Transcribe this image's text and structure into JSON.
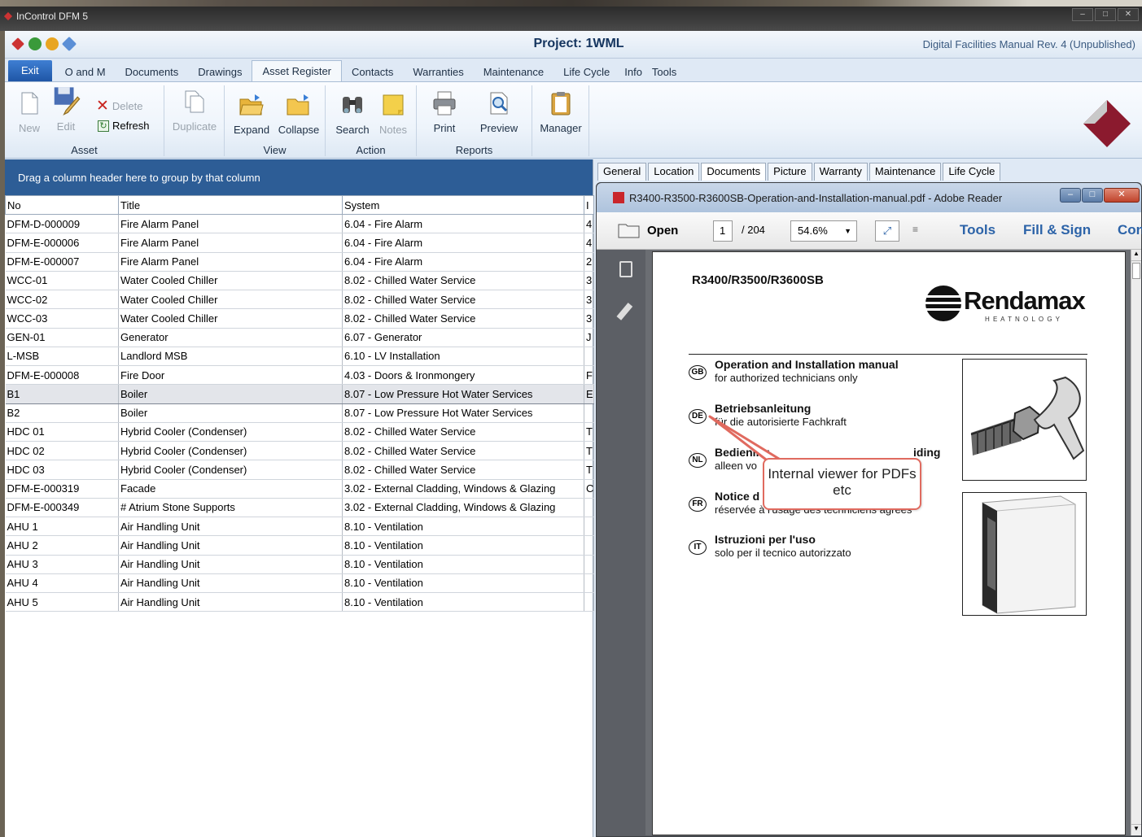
{
  "window": {
    "app_name": "InControl DFM 5"
  },
  "header": {
    "project_title": "Project: 1WML",
    "manual_rev": "Digital Facilities Manual Rev. 4 (Unpublished)"
  },
  "tabs": [
    "Exit",
    "O and M",
    "Documents",
    "Drawings",
    "Asset Register",
    "Contacts",
    "Warranties",
    "Maintenance",
    "Life Cycle",
    "Info",
    "Tools"
  ],
  "ribbon": {
    "asset": {
      "label": "Asset",
      "new": "New",
      "edit": "Edit",
      "delete": "Delete",
      "refresh": "Refresh",
      "duplicate": "Duplicate"
    },
    "view": {
      "label": "View",
      "expand": "Expand",
      "collapse": "Collapse"
    },
    "action": {
      "label": "Action",
      "search": "Search",
      "notes": "Notes"
    },
    "reports": {
      "label": "Reports",
      "print": "Print",
      "preview": "Preview"
    },
    "manager": "Manager"
  },
  "grid": {
    "group_hint": "Drag a column header here to group by that column",
    "columns": [
      "No",
      "Title",
      "System",
      "I"
    ],
    "rows": [
      [
        "DFM-D-000009",
        "Fire Alarm Panel",
        "6.04 - Fire Alarm",
        "4"
      ],
      [
        "DFM-E-000006",
        "Fire Alarm Panel",
        "6.04 - Fire Alarm",
        "4"
      ],
      [
        "DFM-E-000007",
        "Fire Alarm Panel",
        "6.04 - Fire Alarm",
        "2"
      ],
      [
        "WCC-01",
        "Water Cooled Chiller",
        "8.02 - Chilled Water Service",
        "3"
      ],
      [
        "WCC-02",
        "Water Cooled Chiller",
        "8.02 - Chilled Water Service",
        "3"
      ],
      [
        "WCC-03",
        "Water Cooled Chiller",
        "8.02 - Chilled Water Service",
        "3"
      ],
      [
        "GEN-01",
        "Generator",
        "6.07 - Generator",
        "J"
      ],
      [
        "L-MSB",
        "Landlord MSB",
        "6.10 - LV Installation",
        ""
      ],
      [
        "DFM-E-000008",
        "Fire Door",
        "4.03 - Doors & Ironmongery",
        "F"
      ],
      [
        "B1",
        "Boiler",
        "8.07 - Low Pressure Hot Water Services",
        "E"
      ],
      [
        "B2",
        "Boiler",
        "8.07 - Low Pressure Hot Water Services",
        ""
      ],
      [
        "HDC 01",
        "Hybrid Cooler (Condenser)",
        "8.02 - Chilled Water Service",
        "T"
      ],
      [
        "HDC 02",
        "Hybrid Cooler (Condenser)",
        "8.02 - Chilled Water Service",
        "T"
      ],
      [
        "HDC 03",
        "Hybrid Cooler (Condenser)",
        "8.02 - Chilled Water Service",
        "T"
      ],
      [
        "DFM-E-000319",
        "Facade",
        "3.02 - External Cladding, Windows & Glazing",
        "C"
      ],
      [
        "DFM-E-000349",
        "# Atrium Stone Supports",
        "3.02 - External Cladding, Windows & Glazing",
        ""
      ],
      [
        "AHU 1",
        "Air Handling Unit",
        "8.10 - Ventilation",
        ""
      ],
      [
        "AHU 2",
        "Air Handling Unit",
        "8.10 - Ventilation",
        ""
      ],
      [
        "AHU 3",
        "Air Handling Unit",
        "8.10 - Ventilation",
        ""
      ],
      [
        "AHU 4",
        "Air Handling Unit",
        "8.10 - Ventilation",
        ""
      ],
      [
        "AHU 5",
        "Air Handling Unit",
        "8.10 - Ventilation",
        ""
      ]
    ],
    "selected_row": 9
  },
  "detail_tabs": [
    "General",
    "Location",
    "Documents",
    "Picture",
    "Warranty",
    "Maintenance",
    "Life Cycle"
  ],
  "reader": {
    "title": "R3400-R3500-R3600SB-Operation-and-Installation-manual.pdf - Adobe Reader",
    "open": "Open",
    "page_current": "1",
    "page_total": "/ 204",
    "zoom": "54.6%",
    "tools": "Tools",
    "fill_sign": "Fill & Sign",
    "comment": "Con"
  },
  "pdf": {
    "model": "R3400/R3500/R3600SB",
    "brand": "Rendamax",
    "brand_tag": "H E A T N O L O G Y",
    "languages": [
      {
        "code": "GB",
        "title": "Operation and Installation manual",
        "sub": "for authorized technicians only"
      },
      {
        "code": "DE",
        "title": "Betriebsanleitung",
        "sub": "für die autorisierte Fachkraft"
      },
      {
        "code": "NL",
        "title": "Bediening",
        "sub": "alleen vo",
        "title_tail": "iding"
      },
      {
        "code": "FR",
        "title": "Notice d",
        "sub": "réservée à l'usage des techniciens agréés"
      },
      {
        "code": "IT",
        "title": "Istruzioni per l'uso",
        "sub": "solo per il tecnico autorizzato"
      }
    ]
  },
  "callout": "Internal viewer for PDFs etc"
}
